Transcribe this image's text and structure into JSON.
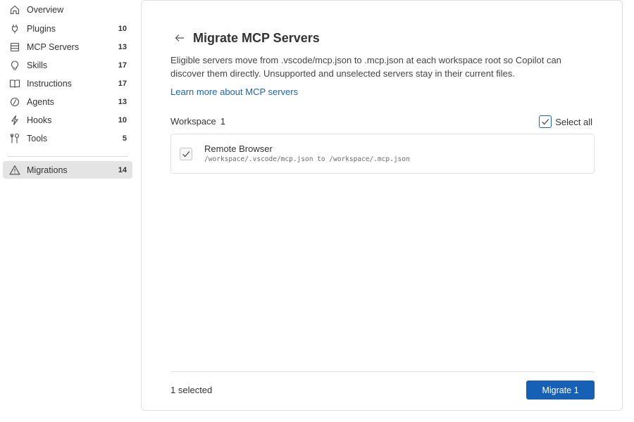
{
  "sidebar": {
    "items": [
      {
        "label": "Overview",
        "count": "",
        "icon": "home-icon"
      },
      {
        "label": "Plugins",
        "count": "10",
        "icon": "plug-icon"
      },
      {
        "label": "MCP Servers",
        "count": "13",
        "icon": "server-icon"
      },
      {
        "label": "Skills",
        "count": "17",
        "icon": "lightbulb-icon"
      },
      {
        "label": "Instructions",
        "count": "17",
        "icon": "book-icon"
      },
      {
        "label": "Agents",
        "count": "13",
        "icon": "agent-icon"
      },
      {
        "label": "Hooks",
        "count": "10",
        "icon": "lightning-icon"
      },
      {
        "label": "Tools",
        "count": "5",
        "icon": "tools-icon"
      }
    ],
    "migrations": {
      "label": "Migrations",
      "count": "14",
      "icon": "warning-icon"
    }
  },
  "main": {
    "title": "Migrate MCP Servers",
    "description": "Eligible servers move from .vscode/mcp.json to .mcp.json at each workspace root so Copilot can discover them directly. Unsupported and unselected servers stay in their current files.",
    "learn_more": "Learn more about MCP servers",
    "workspace": {
      "label": "Workspace",
      "count": "1"
    },
    "select_all": "Select all",
    "servers": [
      {
        "name": "Remote Browser",
        "path": "/workspace/.vscode/mcp.json to /workspace/.mcp.json",
        "checked": true
      }
    ],
    "selected_text": "1 selected",
    "migrate_label": "Migrate 1"
  },
  "colors": {
    "accent": "#1660b5",
    "link": "#1a64b8",
    "active_bg": "#e4e4e4"
  }
}
